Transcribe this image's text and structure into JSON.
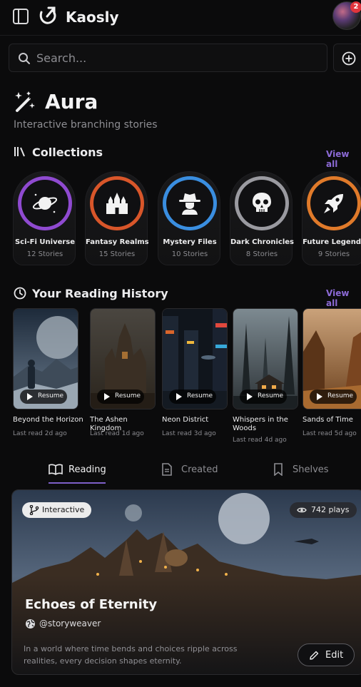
{
  "header": {
    "brand": "Kaosly",
    "notification_count": "2"
  },
  "search": {
    "placeholder": "Search..."
  },
  "hero": {
    "title": "Aura",
    "subtitle": "Interactive branching stories"
  },
  "collections": {
    "title": "Collections",
    "view_all": "View all",
    "items": [
      {
        "name": "Sci-Fi Universe",
        "count": "12 Stories",
        "icon": "planet-icon",
        "ring": "#8f4ad0"
      },
      {
        "name": "Fantasy Realms",
        "count": "15 Stories",
        "icon": "castle-icon",
        "ring": "#d8562a"
      },
      {
        "name": "Mystery Files",
        "count": "10 Stories",
        "icon": "detective-icon",
        "ring": "#3a8ee0"
      },
      {
        "name": "Dark Chronicles",
        "count": "8 Stories",
        "icon": "skull-icon",
        "ring": "#9a9aa0"
      },
      {
        "name": "Future Legends",
        "count": "9 Stories",
        "icon": "rocket-icon",
        "ring": "#e07a2a"
      }
    ]
  },
  "history": {
    "title": "Your Reading History",
    "view_all": "View all",
    "resume_label": "Resume",
    "items": [
      {
        "title": "Beyond the Horizon",
        "meta": "Last read 2d ago"
      },
      {
        "title": "The Ashen Kingdom",
        "meta": "Last read 1d ago"
      },
      {
        "title": "Neon District",
        "meta": "Last read 3d ago"
      },
      {
        "title": "Whispers in the Woods",
        "meta": "Last read 4d ago"
      },
      {
        "title": "Sands of Time",
        "meta": "Last read 5d ago"
      }
    ]
  },
  "tabs": [
    {
      "label": "Reading",
      "active": true
    },
    {
      "label": "Created",
      "active": false
    },
    {
      "label": "Shelves",
      "active": false
    }
  ],
  "featured": {
    "badge": "Interactive",
    "plays": "742 plays",
    "title": "Echoes of Eternity",
    "author": "@storyweaver",
    "description": "In a world where time bends and choices ripple across realities, every decision shapes eternity.",
    "edit_label": "Edit"
  },
  "colors": {
    "accent": "#8c6ad6",
    "background": "#0b0b0c"
  }
}
